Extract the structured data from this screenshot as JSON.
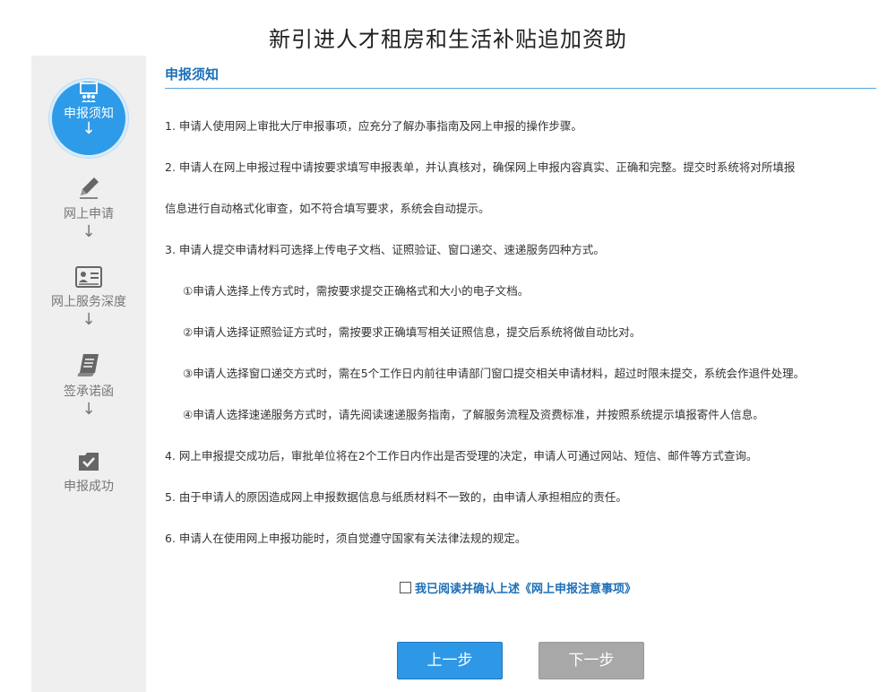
{
  "title": "新引进人才租房和生活补贴追加资助",
  "steps": [
    {
      "label": "申报须知",
      "icon": "presentation-icon",
      "active": true
    },
    {
      "label": "网上申请",
      "icon": "pencil-icon"
    },
    {
      "label": "网上服务深度",
      "icon": "id-card-icon"
    },
    {
      "label": "签承诺函",
      "icon": "scroll-icon"
    },
    {
      "label": "申报成功",
      "icon": "checked-folder-icon"
    }
  ],
  "arrow": "↓",
  "section_title": "申报须知",
  "items": [
    "1. 申请人使用网上审批大厅申报事项，应充分了解办事指南及网上申报的操作步骤。",
    "2. 申请人在网上申报过程中请按要求填写申报表单，并认真核对，确保网上申报内容真实、正确和完整。提交时系统将对所填报",
    "信息进行自动格式化审查，如不符合填写要求，系统会自动提示。",
    "3. 申请人提交申请材料可选择上传电子文档、证照验证、窗口递交、速递服务四种方式。",
    "①申请人选择上传方式时，需按要求提交正确格式和大小的电子文档。",
    "②申请人选择证照验证方式时，需按要求正确填写相关证照信息，提交后系统将做自动比对。",
    "③申请人选择窗口递交方式时，需在5个工作日内前往申请部门窗口提交相关申请材料，超过时限未提交，系统会作退件处理。",
    "④申请人选择速递服务方式时，请先阅读速递服务指南，了解服务流程及资费标准，并按照系统提示填报寄件人信息。",
    "4. 网上申报提交成功后，审批单位将在2个工作日内作出是否受理的决定，申请人可通过网站、短信、邮件等方式查询。",
    "5. 由于申请人的原因造成网上申报数据信息与纸质材料不一致的，由申请人承担相应的责任。",
    "6. 申请人在使用网上申报功能时，须自觉遵守国家有关法律法规的规定。"
  ],
  "agree_label": "我已阅读并确认上述《网上申报注意事项》",
  "buttons": {
    "prev": "上一步",
    "next": "下一步"
  },
  "colors": {
    "accent": "#2e9be8",
    "sidebar_bg": "#efefef",
    "disabled": "#a8a8a8"
  }
}
